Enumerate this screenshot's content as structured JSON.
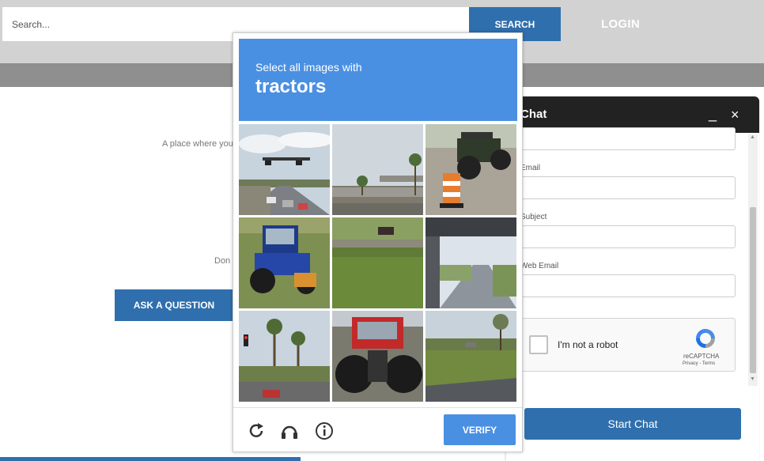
{
  "header": {
    "search_placeholder": "Search...",
    "search_button": "SEARCH",
    "login": "LOGIN"
  },
  "main": {
    "tagline": "A place where you",
    "partial_text": "Don",
    "ask_button": "ASK A QUESTION"
  },
  "chat": {
    "title": "Chat",
    "minimize": "_",
    "close": "×",
    "fields": [
      {
        "label": "Email"
      },
      {
        "label": "Subject"
      },
      {
        "label": "Web Email"
      }
    ],
    "recaptcha": {
      "label": "I'm not a robot",
      "brand": "reCAPTCHA",
      "links": "Privacy - Terms"
    },
    "start_button": "Start Chat"
  },
  "captcha": {
    "instruction": "Select all images with",
    "target": "tractors",
    "tiles": [
      "street-intersection",
      "overpass-palm-tree",
      "green-tractor-cone",
      "blue-tractor",
      "grass-field-car",
      "road-under-bridge",
      "street-traffic-light",
      "red-tractor-rear",
      "grass-roadside"
    ],
    "verify_button": "VERIFY",
    "icons": [
      "reload-icon",
      "audio-icon",
      "info-icon"
    ],
    "colors": {
      "accent": "#4a90e2",
      "page_accent": "#2f6fad"
    }
  }
}
